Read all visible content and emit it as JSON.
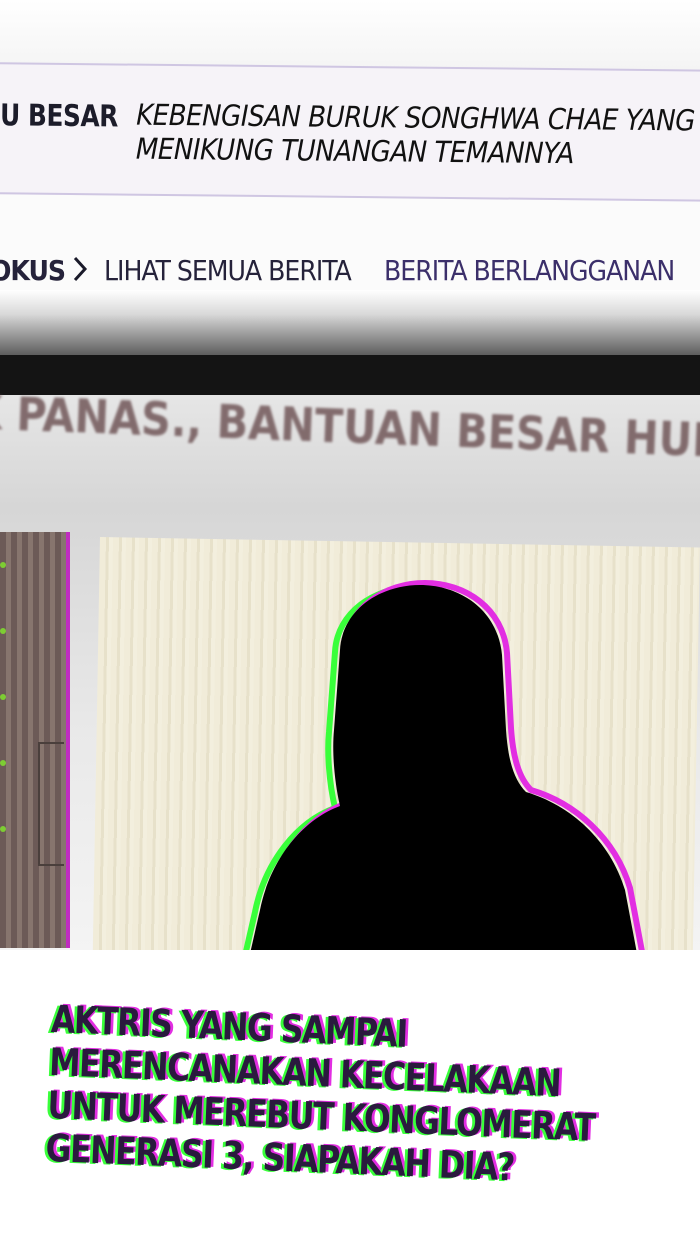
{
  "ticker": {
    "label": "U BESAR",
    "headline_line1": "KEBENGISAN BURUK SONGHWA CHAE YANG",
    "headline_line2": "MENIKUNG TUNANGAN TEMANNYA"
  },
  "nav": {
    "fokus": "OKUS",
    "all_news": "LIHAT SEMUA BERITA",
    "subscribed": "BERITA BERLANGGANAN"
  },
  "blurred_headline": "K PANAS., BANTUAN BESAR HUKUM DINAMI",
  "story": {
    "title": "AKTRIS YANG SAMPAI MERENCANAKAN KECELAKAAN UNTUK MEREBUT KONGLOMERAT GENERASI 3, SIAPAKAH DIA?"
  },
  "colors": {
    "glitch_green": "#39ff3a",
    "glitch_magenta": "#e22ee2",
    "nav_accent": "#3b2f6a"
  },
  "icons": [
    "chevron-right-icon",
    "person-silhouette-icon"
  ]
}
